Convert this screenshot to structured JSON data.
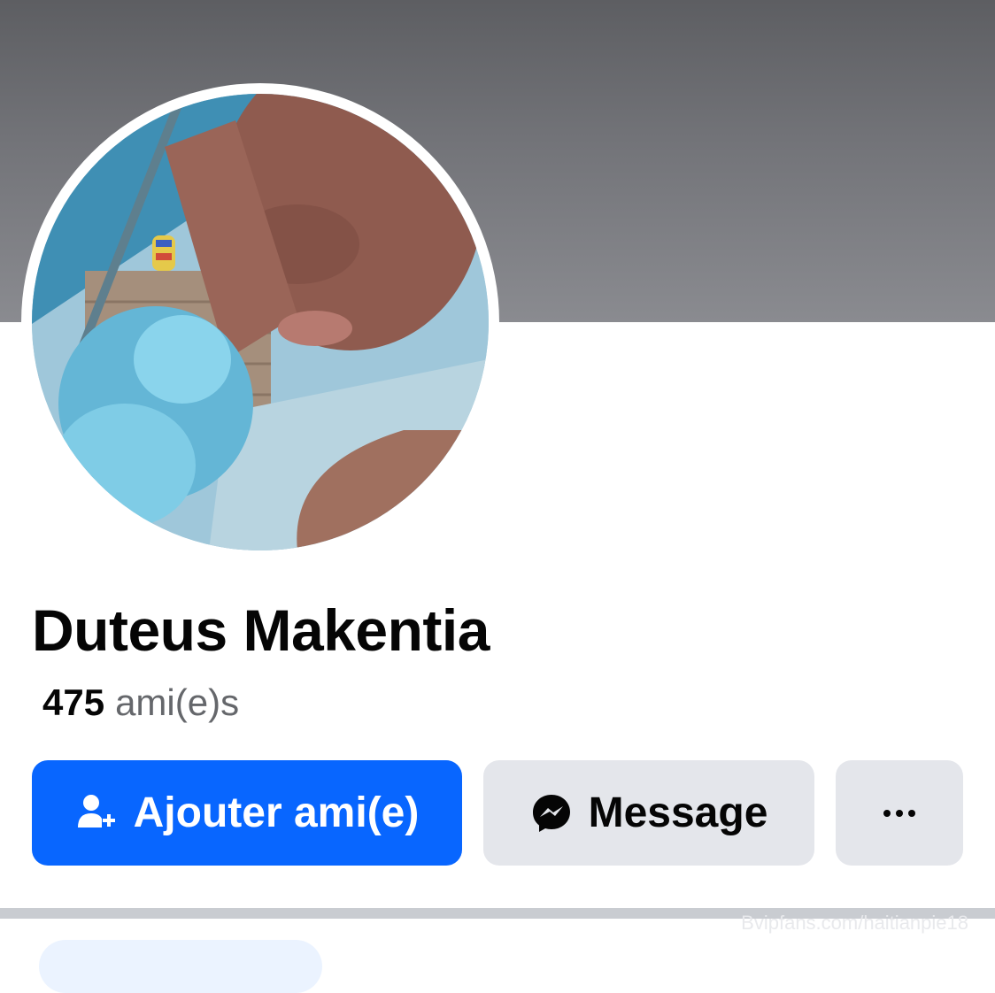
{
  "profile": {
    "name": "Duteus Makentia",
    "friends_count": "475",
    "friends_label": "ami(e)s"
  },
  "actions": {
    "add_friend_label": "Ajouter ami(e)",
    "message_label": "Message",
    "more_label": "···"
  },
  "watermark": "Bvipfans.com/haitianpie18",
  "colors": {
    "primary": "#0866ff",
    "secondary_button": "#e4e6eb",
    "text_primary": "#050505",
    "text_secondary": "#65676b"
  },
  "icons": {
    "add_friend": "person-plus-icon",
    "message": "messenger-icon",
    "more": "more-dots-icon"
  }
}
